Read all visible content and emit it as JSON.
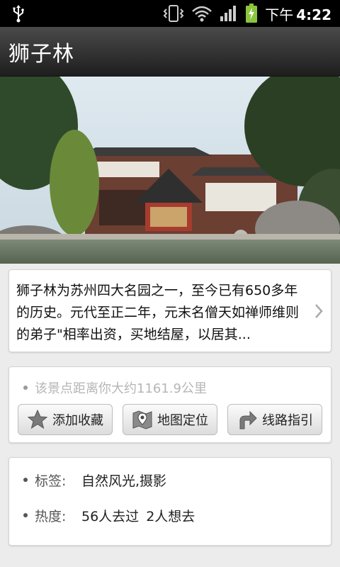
{
  "status_bar": {
    "ampm": "下午",
    "time": "4:22",
    "icons": [
      "usb-icon",
      "vibrate-icon",
      "wifi-icon",
      "signal-icon",
      "battery-charging-icon"
    ]
  },
  "header": {
    "title": "狮子林"
  },
  "description": {
    "text": "狮子林为苏州四大名园之一，至今已有650多年的历史。元代至正二年，元末名僧天如禅师维则的弟子\"相率出资，买地结屋，以居其..."
  },
  "actions": {
    "distance_text": "该景点距离你大约1161.9公里",
    "favorite_label": "添加收藏",
    "map_label": "地图定位",
    "route_label": "线路指引"
  },
  "info": {
    "tags_label": "标签:",
    "tags_value": "自然风光,摄影",
    "heat_label": "热度:",
    "visited": "56人去过",
    "want": "2人想去"
  },
  "colors": {
    "status_bar_bg": "#000000",
    "title_bar_bg": "#333333",
    "page_bg": "#ececec",
    "battery_green": "#8bc53f"
  }
}
